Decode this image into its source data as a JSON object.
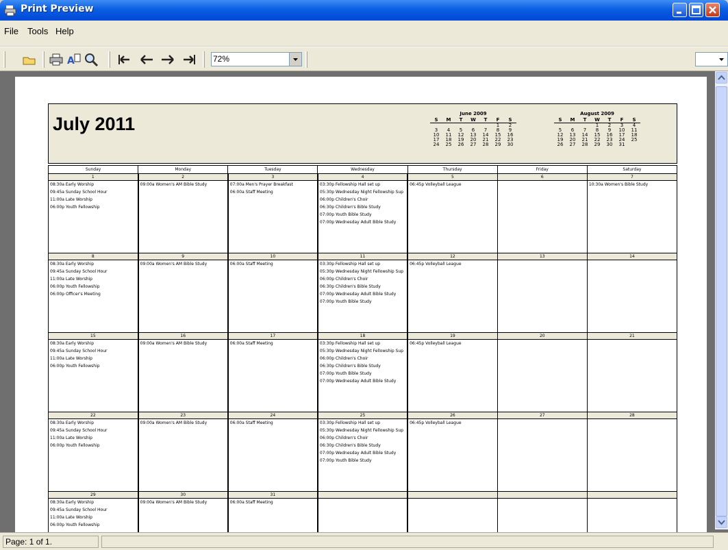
{
  "window": {
    "title": "Print Preview"
  },
  "menu": [
    "File",
    "Tools",
    "Help"
  ],
  "toolbar": {
    "zoom": "72%",
    "icons": [
      "open-icon",
      "print-icon",
      "page-setup-icon",
      "zoom-icon",
      "first-page-icon",
      "previous-page-icon",
      "next-page-icon",
      "last-page-icon"
    ]
  },
  "status": {
    "page": "Page: 1 of 1."
  },
  "calendar": {
    "title": "July 2011",
    "day_names": [
      "Sunday",
      "Monday",
      "Tuesday",
      "Wednesday",
      "Thursday",
      "Friday",
      "Saturday"
    ],
    "mini_left": {
      "title": "June 2009",
      "days": [
        "S",
        "M",
        "T",
        "W",
        "T",
        "F",
        "S"
      ],
      "rows": [
        [
          "",
          "",
          "",
          "",
          "",
          "1",
          "2"
        ],
        [
          "3",
          "4",
          "5",
          "6",
          "7",
          "8",
          "9"
        ],
        [
          "10",
          "11",
          "12",
          "13",
          "14",
          "15",
          "16"
        ],
        [
          "17",
          "18",
          "19",
          "20",
          "21",
          "22",
          "23"
        ],
        [
          "24",
          "25",
          "26",
          "27",
          "28",
          "29",
          "30"
        ]
      ]
    },
    "mini_right": {
      "title": "August 2009",
      "days": [
        "S",
        "M",
        "T",
        "W",
        "T",
        "F",
        "S"
      ],
      "rows": [
        [
          "",
          "",
          "",
          "1",
          "2",
          "3",
          "4"
        ],
        [
          "5",
          "6",
          "7",
          "8",
          "9",
          "10",
          "11"
        ],
        [
          "12",
          "13",
          "14",
          "15",
          "16",
          "17",
          "18"
        ],
        [
          "19",
          "20",
          "21",
          "22",
          "23",
          "24",
          "25"
        ],
        [
          "26",
          "27",
          "28",
          "29",
          "30",
          "31",
          ""
        ]
      ]
    },
    "weeks": [
      [
        {
          "d": "1",
          "ev": [
            "08:30a Early Worship",
            "09:45a Sunday School Hour",
            "11:00a Late Worship",
            "06:00p Youth Fellowship"
          ]
        },
        {
          "d": "2",
          "ev": [
            "09:00a Women's AM Bible Study"
          ]
        },
        {
          "d": "3",
          "ev": [
            "07:00a Men's Prayer Breakfast",
            "06:00a Staff Meeting"
          ]
        },
        {
          "d": "4",
          "ev": [
            "03:30p Fellowship Hall set up",
            "05:30p Wednesday Night Fellowship Sup",
            "06:00p Children's Choir",
            "06:30p Children's Bible Study",
            "07:00p Youth Bible Study",
            "07:00p Wednesday Adult Bible Study"
          ]
        },
        {
          "d": "5",
          "ev": [
            "06:45p Volleyball League"
          ]
        },
        {
          "d": "6",
          "ev": []
        },
        {
          "d": "7",
          "ev": [
            "10:30a Women's Bible Study"
          ]
        }
      ],
      [
        {
          "d": "8",
          "ev": [
            "08:30a Early Worship",
            "09:45a Sunday School Hour",
            "11:00a Late Worship",
            "06:00p Youth Fellowship",
            "06:00p Officer's Meeting"
          ]
        },
        {
          "d": "9",
          "ev": [
            "09:00a Women's AM Bible Study"
          ]
        },
        {
          "d": "10",
          "ev": [
            "06:00a Staff Meeting"
          ]
        },
        {
          "d": "11",
          "ev": [
            "03:30p Fellowship Hall set up",
            "05:30p Wednesday Night Fellowship Sup",
            "06:00p Children's Choir",
            "06:30p Children's Bible Study",
            "07:00p Wednesday Adult Bible Study",
            "07:00p Youth Bible Study"
          ]
        },
        {
          "d": "12",
          "ev": [
            "06:45p Volleyball League"
          ]
        },
        {
          "d": "13",
          "ev": []
        },
        {
          "d": "14",
          "ev": []
        }
      ],
      [
        {
          "d": "15",
          "ev": [
            "08:30a Early Worship",
            "09:45a Sunday School Hour",
            "11:00a Late Worship",
            "06:00p Youth Fellowship"
          ]
        },
        {
          "d": "16",
          "ev": [
            "09:00a Women's AM Bible Study"
          ]
        },
        {
          "d": "17",
          "ev": [
            "06:00a Staff Meeting"
          ]
        },
        {
          "d": "18",
          "ev": [
            "03:30p Fellowship Hall set up",
            "05:30p Wednesday Night Fellowship Sup",
            "06:00p Children's Choir",
            "06:30p Children's Bible Study",
            "07:00p Youth Bible Study",
            "07:00p Wednesday Adult Bible Study"
          ]
        },
        {
          "d": "19",
          "ev": [
            "06:45p Volleyball League"
          ]
        },
        {
          "d": "20",
          "ev": []
        },
        {
          "d": "21",
          "ev": []
        }
      ],
      [
        {
          "d": "22",
          "ev": [
            "08:30a Early Worship",
            "09:45a Sunday School Hour",
            "11:00a Late Worship",
            "06:00p Youth Fellowship"
          ]
        },
        {
          "d": "23",
          "ev": [
            "09:00a Women's AM Bible Study"
          ]
        },
        {
          "d": "24",
          "ev": [
            "06:00a Staff Meeting"
          ]
        },
        {
          "d": "25",
          "ev": [
            "03:30p Fellowship Hall set up",
            "05:30p Wednesday Night Fellowship Sup",
            "06:00p Children's Choir",
            "06:30p Children's Bible Study",
            "07:00p Wednesday Adult Bible Study",
            "07:00p Youth Bible Study"
          ]
        },
        {
          "d": "26",
          "ev": [
            "06:45p Volleyball League"
          ]
        },
        {
          "d": "27",
          "ev": []
        },
        {
          "d": "28",
          "ev": []
        }
      ],
      [
        {
          "d": "29",
          "ev": [
            "08:30a Early Worship",
            "09:45a Sunday School Hour",
            "11:00a Late Worship",
            "06:00p Youth Fellowship"
          ]
        },
        {
          "d": "30",
          "ev": [
            "09:00a Women's AM Bible Study"
          ]
        },
        {
          "d": "31",
          "ev": [
            "06:00a Staff Meeting"
          ]
        },
        {
          "d": "",
          "ev": []
        },
        {
          "d": "",
          "ev": []
        },
        {
          "d": "",
          "ev": []
        },
        {
          "d": "",
          "ev": []
        }
      ]
    ]
  }
}
